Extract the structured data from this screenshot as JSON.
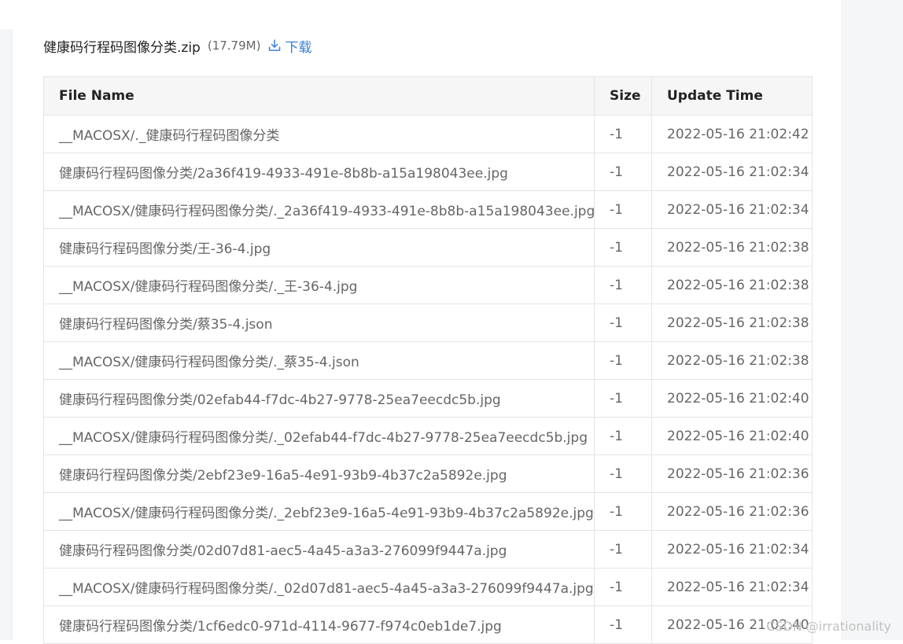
{
  "file": {
    "name": "健康码行程码图像分类.zip",
    "size": "(17.79M)",
    "download_label": "下载",
    "download_icon": "download-icon",
    "link_color": "#3c7fd6"
  },
  "table": {
    "headers": {
      "name": "File Name",
      "size": "Size",
      "time": "Update Time"
    },
    "rows": [
      {
        "name": "__MACOSX/._健康码行程码图像分类",
        "size": "-1",
        "time": "2022-05-16 21:02:42"
      },
      {
        "name": "健康码行程码图像分类/2a36f419-4933-491e-8b8b-a15a198043ee.jpg",
        "size": "-1",
        "time": "2022-05-16 21:02:34"
      },
      {
        "name": "__MACOSX/健康码行程码图像分类/._2a36f419-4933-491e-8b8b-a15a198043ee.jpg",
        "size": "-1",
        "time": "2022-05-16 21:02:34"
      },
      {
        "name": "健康码行程码图像分类/王-36-4.jpg",
        "size": "-1",
        "time": "2022-05-16 21:02:38"
      },
      {
        "name": "__MACOSX/健康码行程码图像分类/._王-36-4.jpg",
        "size": "-1",
        "time": "2022-05-16 21:02:38"
      },
      {
        "name": "健康码行程码图像分类/蔡35-4.json",
        "size": "-1",
        "time": "2022-05-16 21:02:38"
      },
      {
        "name": "__MACOSX/健康码行程码图像分类/._蔡35-4.json",
        "size": "-1",
        "time": "2022-05-16 21:02:38"
      },
      {
        "name": "健康码行程码图像分类/02efab44-f7dc-4b27-9778-25ea7eecdc5b.jpg",
        "size": "-1",
        "time": "2022-05-16 21:02:40"
      },
      {
        "name": "__MACOSX/健康码行程码图像分类/._02efab44-f7dc-4b27-9778-25ea7eecdc5b.jpg",
        "size": "-1",
        "time": "2022-05-16 21:02:40"
      },
      {
        "name": "健康码行程码图像分类/2ebf23e9-16a5-4e91-93b9-4b37c2a5892e.jpg",
        "size": "-1",
        "time": "2022-05-16 21:02:36"
      },
      {
        "name": "__MACOSX/健康码行程码图像分类/._2ebf23e9-16a5-4e91-93b9-4b37c2a5892e.jpg",
        "size": "-1",
        "time": "2022-05-16 21:02:36"
      },
      {
        "name": "健康码行程码图像分类/02d07d81-aec5-4a45-a3a3-276099f9447a.jpg",
        "size": "-1",
        "time": "2022-05-16 21:02:34"
      },
      {
        "name": "__MACOSX/健康码行程码图像分类/._02d07d81-aec5-4a45-a3a3-276099f9447a.jpg",
        "size": "-1",
        "time": "2022-05-16 21:02:34"
      },
      {
        "name": "健康码行程码图像分类/1cf6edc0-971d-4114-9677-f974c0eb1de7.jpg",
        "size": "-1",
        "time": "2022-05-16 21:02:40"
      }
    ]
  },
  "watermark": "CSDN @irrationality"
}
